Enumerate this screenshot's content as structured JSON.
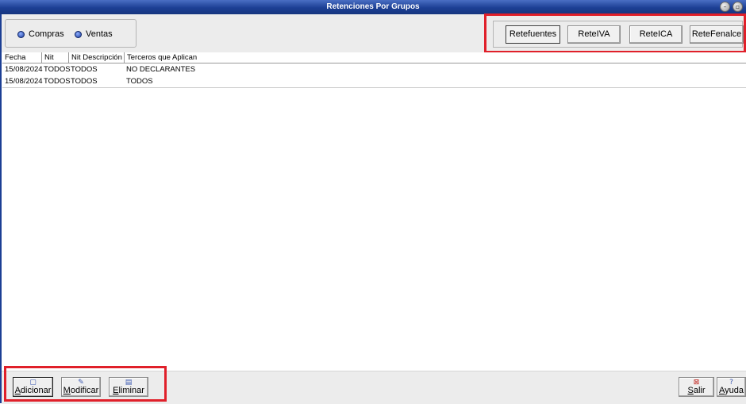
{
  "window": {
    "title": "Retenciones Por Grupos",
    "minimize_glyph": "–",
    "restore_glyph": "▫"
  },
  "radio_group": {
    "options": [
      {
        "label": "Compras",
        "selected": false
      },
      {
        "label": "Ventas",
        "selected": true
      }
    ]
  },
  "tabs": [
    {
      "label": "Retefuentes",
      "active": true
    },
    {
      "label": "ReteIVA",
      "active": false
    },
    {
      "label": "ReteICA",
      "active": false
    },
    {
      "label": "ReteFenalce",
      "active": false
    }
  ],
  "table": {
    "columns": [
      "Fecha",
      "Nit",
      "Nit Descripción",
      "Terceros que Aplican"
    ],
    "rows": [
      [
        "15/08/2024",
        "TODOS",
        "TODOS",
        "NO DECLARANTES"
      ],
      [
        "15/08/2024",
        "TODOS",
        "TODOS",
        "TODOS"
      ]
    ]
  },
  "actions": {
    "adicionar": {
      "label": "Adicionar",
      "icon": "add-icon"
    },
    "modificar": {
      "label": "Modificar",
      "icon": "edit-icon"
    },
    "eliminar": {
      "label": "Eliminar",
      "icon": "delete-icon"
    },
    "salir": {
      "label": "Salir",
      "icon": "exit-icon"
    },
    "ayuda": {
      "label": "Ayuda",
      "icon": "help-icon"
    }
  },
  "colors": {
    "titlebar": "#1c3f94",
    "highlight": "#e0202a",
    "panel": "#ececec"
  }
}
